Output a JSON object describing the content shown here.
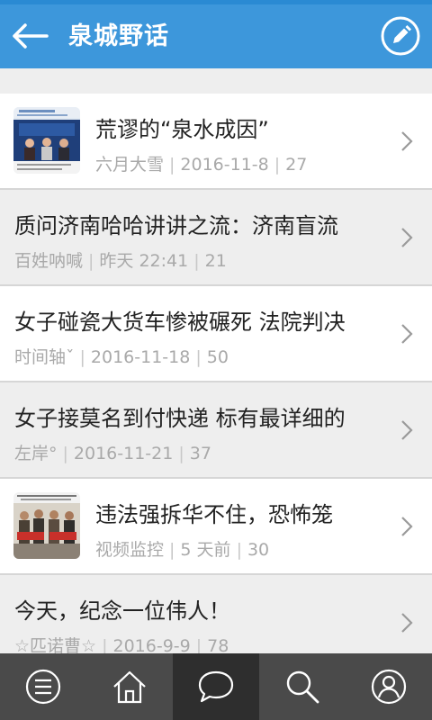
{
  "app_bar": {
    "title": "泉城野话",
    "back_icon": "arrow-left-icon",
    "edit_icon": "pencil-icon",
    "background_color": "#3d97db"
  },
  "posts": [
    {
      "title": "荒谬的“泉水成因”",
      "author": "六月大雪",
      "date": "2016-11-8",
      "replies": "27",
      "has_thumbnail": true,
      "thumbnail": "tv-studio-news-thumbnail"
    },
    {
      "title": "质问济南哈哈讲讲之流：济南盲流",
      "author": "百姓呐喊",
      "date": "昨天 22:41",
      "replies": "21",
      "has_thumbnail": false
    },
    {
      "title": "女子碰瓷大货车惨被碾死 法院判决",
      "author": "时间轴ˇ",
      "date": "2016-11-18",
      "replies": "50",
      "has_thumbnail": false
    },
    {
      "title": "女子接莫名到付快递 标有最详细的",
      "author": "左岸°",
      "date": "2016-11-21",
      "replies": "37",
      "has_thumbnail": false
    },
    {
      "title": "违法强拆华不住，恐怖笼",
      "author": "视频监控",
      "date": "5 天前",
      "replies": "30",
      "has_thumbnail": true,
      "thumbnail": "group-photo-thumbnail"
    },
    {
      "title": "今天，纪念一位伟人！",
      "author": "☆匹诺曹☆",
      "date": "2016-9-9",
      "replies": "78",
      "has_thumbnail": false
    }
  ],
  "meta_separator": "|",
  "tab_bar": {
    "tabs": [
      {
        "icon": "menu-icon",
        "active": false
      },
      {
        "icon": "home-icon",
        "active": false
      },
      {
        "icon": "chat-bubble-icon",
        "active": true
      },
      {
        "icon": "search-icon",
        "active": false
      },
      {
        "icon": "user-icon",
        "active": false
      }
    ]
  }
}
